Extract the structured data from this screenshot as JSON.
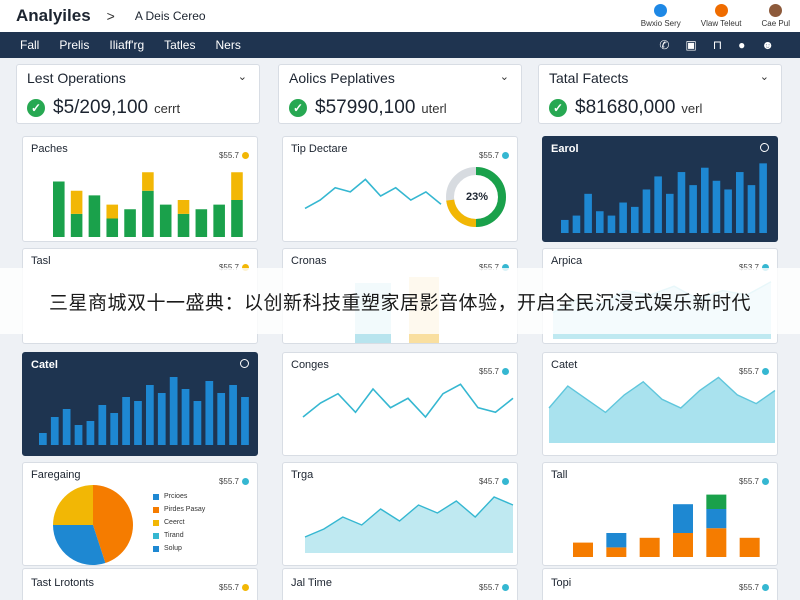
{
  "app": {
    "title": "Analyiles",
    "crumb_sep": ">",
    "crumb": "A Deis Cereo"
  },
  "top_actions": [
    {
      "label": "Bwxio Sery",
      "color": "#1e88e5"
    },
    {
      "label": "Vlaw Teleut",
      "color": "#ef6c00"
    },
    {
      "label": "Cae Pul",
      "color": "#8d5a3b"
    }
  ],
  "nav": {
    "items": [
      "Fall",
      "Prelis",
      "Iliaff'rg",
      "Tatles",
      "Ners"
    ],
    "icons": [
      "phone-icon",
      "bag-icon",
      "lock-icon",
      "alert-icon",
      "user-icon"
    ]
  },
  "stats": [
    {
      "title": "Lest Operations",
      "value": "$5/209,100",
      "unit": "cerrt"
    },
    {
      "title": "Aolics Peplatives",
      "value": "$57990,100",
      "unit": "uterl"
    },
    {
      "title": "Tatal Fatects",
      "value": "$81680,000",
      "unit": "verl"
    }
  ],
  "cards": {
    "c11": {
      "title": "Paches",
      "meta": "$55.7"
    },
    "c12": {
      "title": "Tip Dectare",
      "meta": "$55.7"
    },
    "c13": {
      "title": "Earol"
    },
    "c21": {
      "title": "Tasl",
      "meta": "$55.7"
    },
    "c22": {
      "title": "Cronas",
      "meta": "$55.7"
    },
    "c23": {
      "title": "Arpica",
      "meta": "$53.7"
    },
    "c31": {
      "title": "Catel"
    },
    "c32": {
      "title": "Conges",
      "meta": "$55.7"
    },
    "c33": {
      "title": "Catet",
      "meta": "$55.7"
    },
    "c41": {
      "title": "Faregaing",
      "meta": "$55.7"
    },
    "c42": {
      "title": "Trga",
      "meta": "$45.7"
    },
    "c43": {
      "title": "Tall",
      "meta": "$55.7"
    },
    "c51": {
      "title": "Tast Lrotonts",
      "meta": "$55.7"
    },
    "c52": {
      "title": "Jal Time",
      "meta": "$55.7"
    },
    "c53": {
      "title": "Topi",
      "meta": "$55.7"
    }
  },
  "donut_label": "23%",
  "pie_legend": [
    "Prcioes",
    "Pirdes Pasay",
    "Ceerct",
    "Tirand",
    "Solup"
  ],
  "banner": "三星商城双十一盛典：以创新科技重塑家居影音体验，开启全民沉浸式娱乐新时代",
  "colors": {
    "green": "#1aa14b",
    "yellow": "#f2b705",
    "blue": "#1e88d2",
    "orange": "#f57c00",
    "teal": "#35b7d1",
    "navy": "#1e3450"
  },
  "chart_data": [
    {
      "type": "bar",
      "name": "Paches",
      "series": [
        {
          "color": "green",
          "values": [
            60,
            25,
            45,
            20,
            30,
            50,
            35,
            25,
            30,
            35,
            40
          ]
        },
        {
          "color": "yellow",
          "values": [
            0,
            25,
            0,
            15,
            0,
            20,
            0,
            15,
            0,
            0,
            30
          ]
        }
      ]
    },
    {
      "type": "line",
      "name": "Tip Dectare",
      "values": [
        20,
        30,
        45,
        40,
        55,
        35,
        45,
        30,
        40,
        25
      ]
    },
    {
      "type": "bar",
      "name": "Earol",
      "values": [
        15,
        20,
        45,
        25,
        20,
        35,
        30,
        50,
        65,
        45,
        70,
        55,
        75,
        60,
        50,
        70,
        55,
        80
      ]
    },
    {
      "type": "bar",
      "name": "Catel",
      "values": [
        15,
        35,
        45,
        25,
        30,
        50,
        40,
        60,
        55,
        75,
        65,
        85,
        70,
        55,
        80,
        65,
        75,
        60
      ]
    },
    {
      "type": "line",
      "name": "Conges",
      "values": [
        30,
        45,
        55,
        35,
        60,
        40,
        50,
        30,
        55,
        65,
        40,
        35,
        50
      ]
    },
    {
      "type": "area",
      "name": "Catet",
      "values": [
        40,
        65,
        50,
        35,
        55,
        70,
        50,
        40,
        60,
        75,
        55,
        45,
        60
      ]
    },
    {
      "type": "pie",
      "name": "Faregaing",
      "values": [
        45,
        30,
        25
      ]
    },
    {
      "type": "area",
      "name": "Trga",
      "values": [
        20,
        30,
        45,
        35,
        55,
        40,
        60,
        50,
        65,
        45,
        70,
        60
      ]
    },
    {
      "type": "bar",
      "name": "Tall",
      "series": [
        {
          "color": "orange",
          "values": [
            15,
            10,
            20,
            25,
            30,
            20
          ]
        },
        {
          "color": "blue",
          "values": [
            0,
            15,
            0,
            30,
            20,
            0
          ]
        },
        {
          "color": "green",
          "values": [
            0,
            0,
            0,
            0,
            15,
            0
          ]
        }
      ]
    },
    {
      "type": "area",
      "name": "Arpica",
      "values": [
        30,
        45,
        40,
        55,
        50,
        60,
        45,
        55,
        50,
        65
      ]
    }
  ]
}
